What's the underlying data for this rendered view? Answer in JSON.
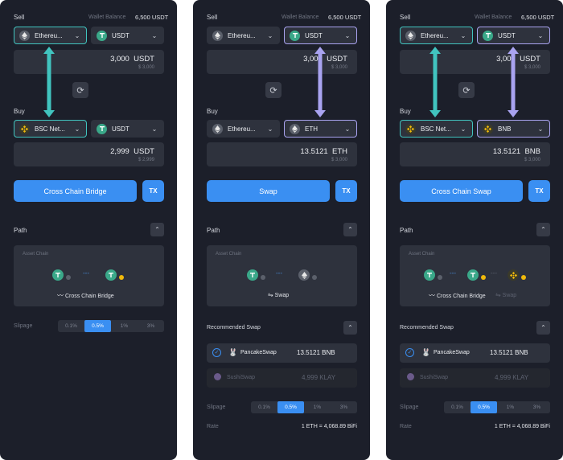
{
  "colors": {
    "teal": "#41c4bf",
    "purple": "#a9a3f0",
    "accent": "#3a8ff2",
    "panel": "#1c1f2a",
    "field": "#2e323d"
  },
  "common": {
    "sell_label": "Sell",
    "buy_label": "Buy",
    "wallet_label": "Wallet Balance",
    "wallet_value": "6,500 USDT",
    "tx_label": "TX",
    "path_label": "Path",
    "asset_chain_label": "Asset Chain",
    "slippage_label": "Slipage",
    "slippage_options": [
      "0.1%",
      "0.5%",
      "1%",
      "3%"
    ],
    "slippage_selected": "0.5%",
    "recommended_label": "Recommended Swap",
    "rate_label": "Rate",
    "rate_value": "1 ETH = 4,068.89 BiFi"
  },
  "panels": [
    {
      "sell_chain": "Ethereu...",
      "sell_token": "USDT",
      "sell_amount": "3,000",
      "sell_unit": "USDT",
      "sell_usd": "$ 3,000",
      "buy_chain": "BSC Net...",
      "buy_token": "USDT",
      "buy_amount": "2,999",
      "buy_unit": "USDT",
      "buy_usd": "$ 2,999",
      "action_label": "Cross Chain Bridge",
      "path_caption": "Cross Chain Bridge"
    },
    {
      "sell_chain": "Ethereu...",
      "sell_token": "USDT",
      "sell_amount": "3,000",
      "sell_unit": "USDT",
      "sell_usd": "$ 3,000",
      "buy_chain": "Ethereu...",
      "buy_token": "ETH",
      "buy_amount": "13.5121",
      "buy_unit": "ETH",
      "buy_usd": "$ 3,000",
      "action_label": "Swap",
      "path_caption": "Swap",
      "rec": [
        {
          "name": "PancakeSwap",
          "value": "13.5121 BNB"
        },
        {
          "name": "SushiSwap",
          "value": "4,999 KLAY"
        }
      ]
    },
    {
      "sell_chain": "Ethereu...",
      "sell_token": "USDT",
      "sell_amount": "3,000",
      "sell_unit": "USDT",
      "sell_usd": "$ 3,000",
      "buy_chain": "BSC Net...",
      "buy_token": "BNB",
      "buy_amount": "13.5121",
      "buy_unit": "BNB",
      "buy_usd": "$ 3,000",
      "action_label": "Cross Chain Swap",
      "path_caption": "Cross Chain Bridge",
      "path_caption2": "Swap",
      "rec": [
        {
          "name": "PancakeSwap",
          "value": "13.5121 BNB"
        },
        {
          "name": "SushiSwap",
          "value": "4,999 KLAY"
        }
      ]
    }
  ]
}
